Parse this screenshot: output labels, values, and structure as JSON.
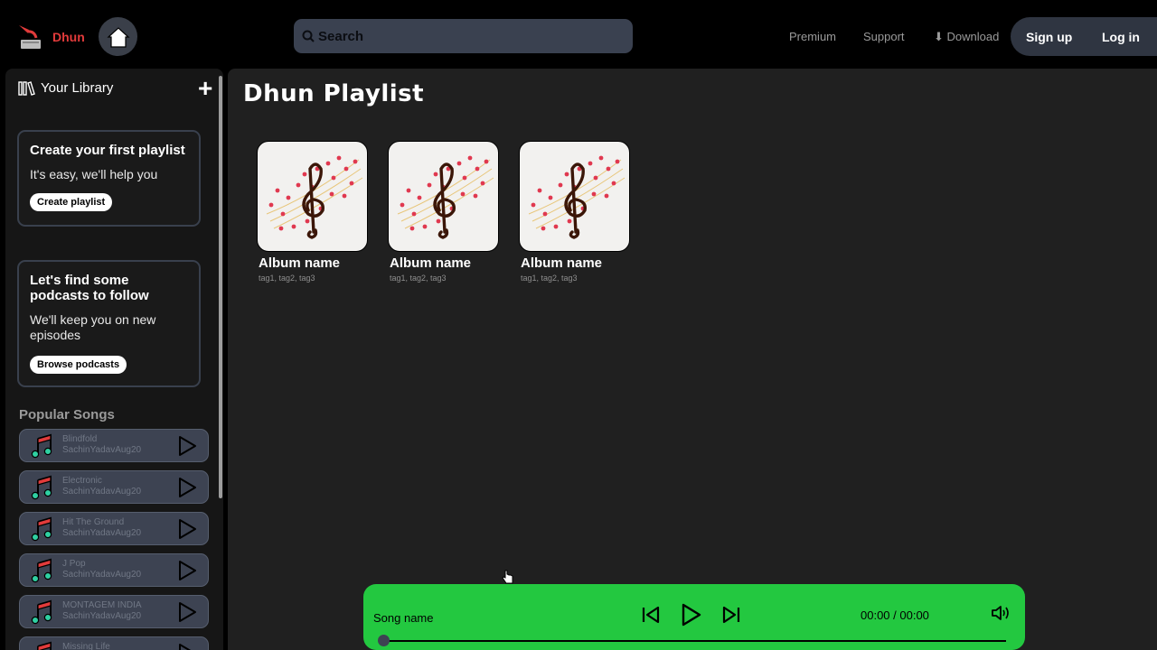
{
  "brand": {
    "name": "Dhun"
  },
  "search": {
    "placeholder": "Search"
  },
  "nav": {
    "premium": "Premium",
    "support": "Support",
    "download": "⬇ Download"
  },
  "auth": {
    "signup": "Sign up",
    "login": "Log in"
  },
  "library": {
    "title": "Your Library",
    "playlist_card": {
      "title": "Create your first playlist",
      "text": "It's easy, we'll help you",
      "button": "Create playlist"
    },
    "podcast_card": {
      "title": "Let's find some podcasts to follow",
      "text": "We'll keep you on new episodes",
      "button": "Browse podcasts"
    },
    "popular_title": "Popular Songs",
    "songs": [
      {
        "title": "Blindfold",
        "artist": "SachinYadavAug20"
      },
      {
        "title": "Electronic",
        "artist": "SachinYadavAug20"
      },
      {
        "title": "Hit The Ground",
        "artist": "SachinYadavAug20"
      },
      {
        "title": "J Pop",
        "artist": "SachinYadavAug20"
      },
      {
        "title": "MONTAGEM INDIA",
        "artist": "SachinYadavAug20"
      },
      {
        "title": "Missing Life",
        "artist": ""
      }
    ]
  },
  "main": {
    "title": "Dhun Playlist",
    "albums": [
      {
        "name": "Album name",
        "tags": "tag1, tag2, tag3"
      },
      {
        "name": "Album name",
        "tags": "tag1, tag2, tag3"
      },
      {
        "name": "Album name",
        "tags": "tag1, tag2, tag3"
      }
    ]
  },
  "player": {
    "song_name": "Song name",
    "time": "00:00 / 00:00",
    "progress": 0
  },
  "colors": {
    "accent": "#23c840",
    "brand": "#e23b3b",
    "panel": "#3d4352"
  }
}
